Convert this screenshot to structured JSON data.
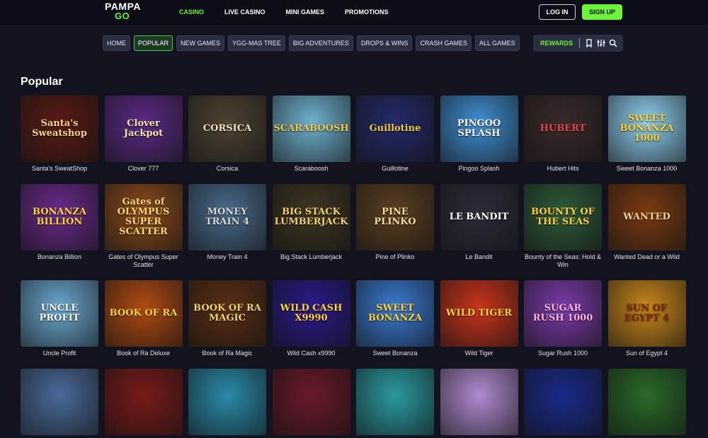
{
  "logo": {
    "line1": "PAMPA",
    "line2": "GO"
  },
  "main_nav": [
    "CASINO",
    "LIVE CASINO",
    "MINI GAMES",
    "PROMOTIONS"
  ],
  "auth": {
    "login": "LOG IN",
    "signup": "SIGN UP"
  },
  "sub_nav": [
    "HOME",
    "POPULAR",
    "NEW GAMES",
    "YGG-MAS TREE",
    "BIG ADVENTURES",
    "DROPS & WINS",
    "CRASH GAMES",
    "ALL GAMES"
  ],
  "rewards_label": "REWARDS",
  "right_icons": [
    "bookmark-icon",
    "filter-sliders-icon",
    "search-icon"
  ],
  "section_title": "Popular",
  "colors": {
    "accent": "#6cf33a",
    "background": "#12131f",
    "topbar": "#0c0d17"
  },
  "games": [
    {
      "name": "Santa's SweatShop",
      "art": "Santa's Sweatshop",
      "bg": "#5a1a14",
      "fg": "#f2d58a"
    },
    {
      "name": "Clover 777",
      "art": "Clover Jackpot",
      "bg": "#5b2a86",
      "fg": "#f6e7a8"
    },
    {
      "name": "Corsica",
      "art": "CORSICA",
      "bg": "#4e4232",
      "fg": "#f0e0c0"
    },
    {
      "name": "Scaraboosh",
      "art": "SCARABOOSH",
      "bg": "#6fb2cf",
      "fg": "#f3c94c"
    },
    {
      "name": "Guillotine",
      "art": "Guillotine",
      "bg": "#232a6a",
      "fg": "#f1c947"
    },
    {
      "name": "Pingoo Splash",
      "art": "PINGOO SPLASH",
      "bg": "#3f8ed2",
      "fg": "#ffffff"
    },
    {
      "name": "Hubert Hits",
      "art": "HUBERT",
      "bg": "#3a2a2a",
      "fg": "#e8474a"
    },
    {
      "name": "Sweet Bonanza 1000",
      "art": "SWEET BONANZA 1000",
      "bg": "#8ed1f2",
      "fg": "#ffd23a"
    },
    {
      "name": "Bonanza Billion",
      "art": "BONANZA BILLION",
      "bg": "#6a2a8c",
      "fg": "#ffd23a"
    },
    {
      "name": "Gates of Olympus Super Scatter",
      "art": "Gates of OLYMPUS SUPER SCATTER",
      "bg": "#8a4a1c",
      "fg": "#ffd875"
    },
    {
      "name": "Money Train 4",
      "art": "MONEY TRAIN 4",
      "bg": "#4a6a8a",
      "fg": "#d8d8d8"
    },
    {
      "name": "Big Stack Lumberjack",
      "art": "BIG STACK LUMBERJACK",
      "bg": "#3e3522",
      "fg": "#f2d36a"
    },
    {
      "name": "Pine of Plinko",
      "art": "PINE PLINKO",
      "bg": "#5a3f22",
      "fg": "#f4dc9a"
    },
    {
      "name": "Le Bandit",
      "art": "LE BANDIT",
      "bg": "#2a2d3a",
      "fg": "#ffffff"
    },
    {
      "name": "Bounty of the Seas: Hold & Win",
      "art": "BOUNTY OF THE SEAS",
      "bg": "#2e5a3a",
      "fg": "#ffd23a"
    },
    {
      "name": "Wanted Dead or a Wild",
      "art": "WANTED",
      "bg": "#7a3a12",
      "fg": "#f2d58a"
    },
    {
      "name": "Uncle Profit",
      "art": "UNCLE PROFIT",
      "bg": "#6aa8d0",
      "fg": "#ffffff"
    },
    {
      "name": "Book of Ra Deluxe",
      "art": "BOOK OF RA",
      "bg": "#b04a12",
      "fg": "#ffd23a"
    },
    {
      "name": "Book of Ra Magic",
      "art": "BOOK OF RA MAGIC",
      "bg": "#5a2e16",
      "fg": "#f2d36a"
    },
    {
      "name": "Wild Cash x9990",
      "art": "WILD CASH X9990",
      "bg": "#2a1a8a",
      "fg": "#ffd23a"
    },
    {
      "name": "Sweet Bonanza",
      "art": "SWEET BONANZA",
      "bg": "#3a7ad2",
      "fg": "#ffd23a"
    },
    {
      "name": "Wild Tiger",
      "art": "WILD TIGER",
      "bg": "#c8341c",
      "fg": "#ffd23a"
    },
    {
      "name": "Sugar Rush 1000",
      "art": "SUGAR RUSH 1000",
      "bg": "#7a3aa8",
      "fg": "#ffb0e0"
    },
    {
      "name": "Sun of Egypt 4",
      "art": "SUN OF EGYPT 4",
      "bg": "#c8861c",
      "fg": "#7a2a0c"
    },
    {
      "name": "",
      "art": "",
      "bg": "#4a6a9a",
      "fg": "#ffffff"
    },
    {
      "name": "",
      "art": "",
      "bg": "#7a1a1a",
      "fg": "#ffffff"
    },
    {
      "name": "",
      "art": "",
      "bg": "#2a8aa8",
      "fg": "#ffffff"
    },
    {
      "name": "",
      "art": "",
      "bg": "#6a1a2a",
      "fg": "#ffffff"
    },
    {
      "name": "",
      "art": "",
      "bg": "#2a9aa0",
      "fg": "#ffffff"
    },
    {
      "name": "",
      "art": "",
      "bg": "#b08ad0",
      "fg": "#ffffff"
    },
    {
      "name": "",
      "art": "",
      "bg": "#1a2a8a",
      "fg": "#ffffff"
    },
    {
      "name": "",
      "art": "",
      "bg": "#2a6a2a",
      "fg": "#ffffff"
    }
  ]
}
